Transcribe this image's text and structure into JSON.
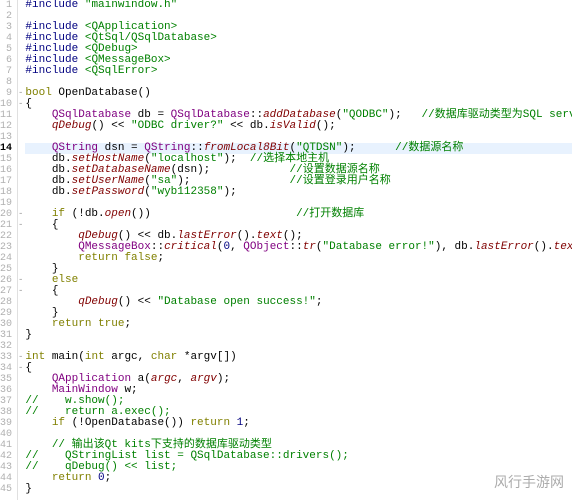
{
  "watermark": "风行手游网",
  "current_line": 14,
  "fold_markers": {
    "9": "-",
    "10": "-",
    "20": "-",
    "21": "-",
    "26": "-",
    "27": "-",
    "33": "-",
    "34": "-"
  },
  "lines": [
    {
      "n": 1,
      "type": "pp",
      "tokens": [
        [
          "pp",
          "#include "
        ],
        [
          "ppstr",
          "\"mainwindow.h\""
        ]
      ]
    },
    {
      "n": 2,
      "type": "blank",
      "tokens": []
    },
    {
      "n": 3,
      "type": "pp",
      "tokens": [
        [
          "pp",
          "#include "
        ],
        [
          "ppstr",
          "<QApplication>"
        ]
      ]
    },
    {
      "n": 4,
      "type": "pp",
      "tokens": [
        [
          "pp",
          "#include "
        ],
        [
          "ppstr",
          "<QtSql/QSqlDatabase>"
        ]
      ]
    },
    {
      "n": 5,
      "type": "pp",
      "tokens": [
        [
          "pp",
          "#include "
        ],
        [
          "ppstr",
          "<QDebug>"
        ]
      ]
    },
    {
      "n": 6,
      "type": "pp",
      "tokens": [
        [
          "pp",
          "#include "
        ],
        [
          "ppstr",
          "<QMessageBox>"
        ]
      ]
    },
    {
      "n": 7,
      "type": "pp",
      "tokens": [
        [
          "pp",
          "#include "
        ],
        [
          "ppstr",
          "<QSqlError>"
        ]
      ]
    },
    {
      "n": 8,
      "type": "blank",
      "tokens": []
    },
    {
      "n": 9,
      "type": "code",
      "tokens": [
        [
          "kw",
          "bool"
        ],
        [
          "var",
          " OpenDatabase"
        ],
        [
          "var",
          "()"
        ]
      ]
    },
    {
      "n": 10,
      "type": "code",
      "tokens": [
        [
          "var",
          "{"
        ]
      ]
    },
    {
      "n": 11,
      "type": "code",
      "tokens": [
        [
          "var",
          "    "
        ],
        [
          "cls",
          "QSqlDatabase"
        ],
        [
          "var",
          " db = "
        ],
        [
          "cls",
          "QSqlDatabase"
        ],
        [
          "var",
          "::"
        ],
        [
          "meth",
          "addDatabase"
        ],
        [
          "var",
          "("
        ],
        [
          "str",
          "\"QODBC\""
        ],
        [
          "var",
          ");   "
        ],
        [
          "cmt",
          "//数据库驱动类型为SQL server"
        ]
      ]
    },
    {
      "n": 12,
      "type": "code",
      "tokens": [
        [
          "var",
          "    "
        ],
        [
          "meth",
          "qDebug"
        ],
        [
          "var",
          "() << "
        ],
        [
          "str",
          "\"ODBC driver?\""
        ],
        [
          "var",
          " << db."
        ],
        [
          "meth",
          "isValid"
        ],
        [
          "var",
          "();"
        ]
      ]
    },
    {
      "n": 13,
      "type": "blank",
      "tokens": []
    },
    {
      "n": 14,
      "type": "code",
      "current": true,
      "tokens": [
        [
          "var",
          "    "
        ],
        [
          "cls",
          "QString"
        ],
        [
          "var",
          " dsn = "
        ],
        [
          "cls",
          "QString"
        ],
        [
          "var",
          "::"
        ],
        [
          "meth",
          "fromLocal8Bit"
        ],
        [
          "var",
          "("
        ],
        [
          "str",
          "\"QTDSN\""
        ],
        [
          "var",
          ");      "
        ],
        [
          "cmt",
          "//数据源名称"
        ]
      ]
    },
    {
      "n": 15,
      "type": "code",
      "tokens": [
        [
          "var",
          "    db."
        ],
        [
          "meth",
          "setHostName"
        ],
        [
          "var",
          "("
        ],
        [
          "str",
          "\"localhost\""
        ],
        [
          "var",
          ");  "
        ],
        [
          "cmt",
          "//选择本地主机"
        ]
      ]
    },
    {
      "n": 16,
      "type": "code",
      "tokens": [
        [
          "var",
          "    db."
        ],
        [
          "meth",
          "setDatabaseName"
        ],
        [
          "var",
          "(dsn);            "
        ],
        [
          "cmt",
          "//设置数据源名称"
        ]
      ]
    },
    {
      "n": 17,
      "type": "code",
      "tokens": [
        [
          "var",
          "    db."
        ],
        [
          "meth",
          "setUserName"
        ],
        [
          "var",
          "("
        ],
        [
          "str",
          "\"sa\""
        ],
        [
          "var",
          ");               "
        ],
        [
          "cmt",
          "//设置登录用户名称"
        ]
      ]
    },
    {
      "n": 18,
      "type": "code",
      "tokens": [
        [
          "var",
          "    db."
        ],
        [
          "meth",
          "setPassword"
        ],
        [
          "var",
          "("
        ],
        [
          "str",
          "\"wyb112358\""
        ],
        [
          "var",
          ");"
        ]
      ]
    },
    {
      "n": 19,
      "type": "blank",
      "tokens": []
    },
    {
      "n": 20,
      "type": "code",
      "tokens": [
        [
          "var",
          "    "
        ],
        [
          "kw",
          "if"
        ],
        [
          "var",
          " (!db."
        ],
        [
          "meth",
          "open"
        ],
        [
          "var",
          "())                      "
        ],
        [
          "cmt",
          "//打开数据库"
        ]
      ]
    },
    {
      "n": 21,
      "type": "code",
      "tokens": [
        [
          "var",
          "    {"
        ]
      ]
    },
    {
      "n": 22,
      "type": "code",
      "tokens": [
        [
          "var",
          "        "
        ],
        [
          "meth",
          "qDebug"
        ],
        [
          "var",
          "() << db."
        ],
        [
          "meth",
          "lastError"
        ],
        [
          "var",
          "()."
        ],
        [
          "meth",
          "text"
        ],
        [
          "var",
          "();"
        ]
      ]
    },
    {
      "n": 23,
      "type": "code",
      "tokens": [
        [
          "var",
          "        "
        ],
        [
          "cls",
          "QMessageBox"
        ],
        [
          "var",
          "::"
        ],
        [
          "meth",
          "critical"
        ],
        [
          "var",
          "("
        ],
        [
          "num",
          "0"
        ],
        [
          "var",
          ", "
        ],
        [
          "cls",
          "QObject"
        ],
        [
          "var",
          "::"
        ],
        [
          "meth",
          "tr"
        ],
        [
          "var",
          "("
        ],
        [
          "str",
          "\"Database error!\""
        ],
        [
          "var",
          "), db."
        ],
        [
          "meth",
          "lastError"
        ],
        [
          "var",
          "()."
        ],
        [
          "meth",
          "text"
        ],
        [
          "var",
          "());"
        ]
      ]
    },
    {
      "n": 24,
      "type": "code",
      "tokens": [
        [
          "var",
          "        "
        ],
        [
          "kw",
          "return"
        ],
        [
          "var",
          " "
        ],
        [
          "kw",
          "false"
        ],
        [
          "var",
          ";"
        ]
      ]
    },
    {
      "n": 25,
      "type": "code",
      "tokens": [
        [
          "var",
          "    }"
        ]
      ]
    },
    {
      "n": 26,
      "type": "code",
      "tokens": [
        [
          "var",
          "    "
        ],
        [
          "kw",
          "else"
        ]
      ]
    },
    {
      "n": 27,
      "type": "code",
      "tokens": [
        [
          "var",
          "    {"
        ]
      ]
    },
    {
      "n": 28,
      "type": "code",
      "tokens": [
        [
          "var",
          "        "
        ],
        [
          "meth",
          "qDebug"
        ],
        [
          "var",
          "() << "
        ],
        [
          "str",
          "\"Database open success!\""
        ],
        [
          "var",
          ";"
        ]
      ]
    },
    {
      "n": 29,
      "type": "code",
      "tokens": [
        [
          "var",
          "    }"
        ]
      ]
    },
    {
      "n": 30,
      "type": "code",
      "tokens": [
        [
          "var",
          "    "
        ],
        [
          "kw",
          "return"
        ],
        [
          "var",
          " "
        ],
        [
          "kw",
          "true"
        ],
        [
          "var",
          ";"
        ]
      ]
    },
    {
      "n": 31,
      "type": "code",
      "tokens": [
        [
          "var",
          "}"
        ]
      ]
    },
    {
      "n": 32,
      "type": "blank",
      "tokens": []
    },
    {
      "n": 33,
      "type": "code",
      "tokens": [
        [
          "kw",
          "int"
        ],
        [
          "var",
          " main("
        ],
        [
          "kw",
          "int"
        ],
        [
          "var",
          " argc, "
        ],
        [
          "kw",
          "char"
        ],
        [
          "var",
          " *argv[])"
        ]
      ]
    },
    {
      "n": 34,
      "type": "code",
      "tokens": [
        [
          "var",
          "{"
        ]
      ]
    },
    {
      "n": 35,
      "type": "code",
      "tokens": [
        [
          "var",
          "    "
        ],
        [
          "cls",
          "QApplication"
        ],
        [
          "var",
          " "
        ],
        [
          "fn",
          "a"
        ],
        [
          "var",
          "("
        ],
        [
          "varit",
          "argc"
        ],
        [
          "var",
          ", "
        ],
        [
          "varit",
          "argv"
        ],
        [
          "var",
          ");"
        ]
      ]
    },
    {
      "n": 36,
      "type": "code",
      "tokens": [
        [
          "var",
          "    "
        ],
        [
          "cls",
          "MainWindow"
        ],
        [
          "var",
          " w;"
        ]
      ]
    },
    {
      "n": 37,
      "type": "code",
      "tokens": [
        [
          "cmt",
          "//    w.show();"
        ]
      ]
    },
    {
      "n": 38,
      "type": "code",
      "tokens": [
        [
          "cmt",
          "//    return a.exec();"
        ]
      ]
    },
    {
      "n": 39,
      "type": "code",
      "tokens": [
        [
          "var",
          "    "
        ],
        [
          "kw",
          "if"
        ],
        [
          "var",
          " (!OpenDatabase()) "
        ],
        [
          "kw",
          "return"
        ],
        [
          "var",
          " "
        ],
        [
          "num",
          "1"
        ],
        [
          "var",
          ";"
        ]
      ]
    },
    {
      "n": 40,
      "type": "blank",
      "tokens": []
    },
    {
      "n": 41,
      "type": "code",
      "tokens": [
        [
          "var",
          "    "
        ],
        [
          "cmt",
          "// 输出该Qt kits下支持的数据库驱动类型"
        ]
      ]
    },
    {
      "n": 42,
      "type": "code",
      "tokens": [
        [
          "cmt",
          "//    QStringList list = QSqlDatabase::drivers();"
        ]
      ]
    },
    {
      "n": 43,
      "type": "code",
      "tokens": [
        [
          "cmt",
          "//    qDebug() << list;"
        ]
      ]
    },
    {
      "n": 44,
      "type": "code",
      "tokens": [
        [
          "var",
          "    "
        ],
        [
          "kw",
          "return"
        ],
        [
          "var",
          " "
        ],
        [
          "num",
          "0"
        ],
        [
          "var",
          ";"
        ]
      ]
    },
    {
      "n": 45,
      "type": "code",
      "tokens": [
        [
          "var",
          "}"
        ]
      ]
    }
  ]
}
